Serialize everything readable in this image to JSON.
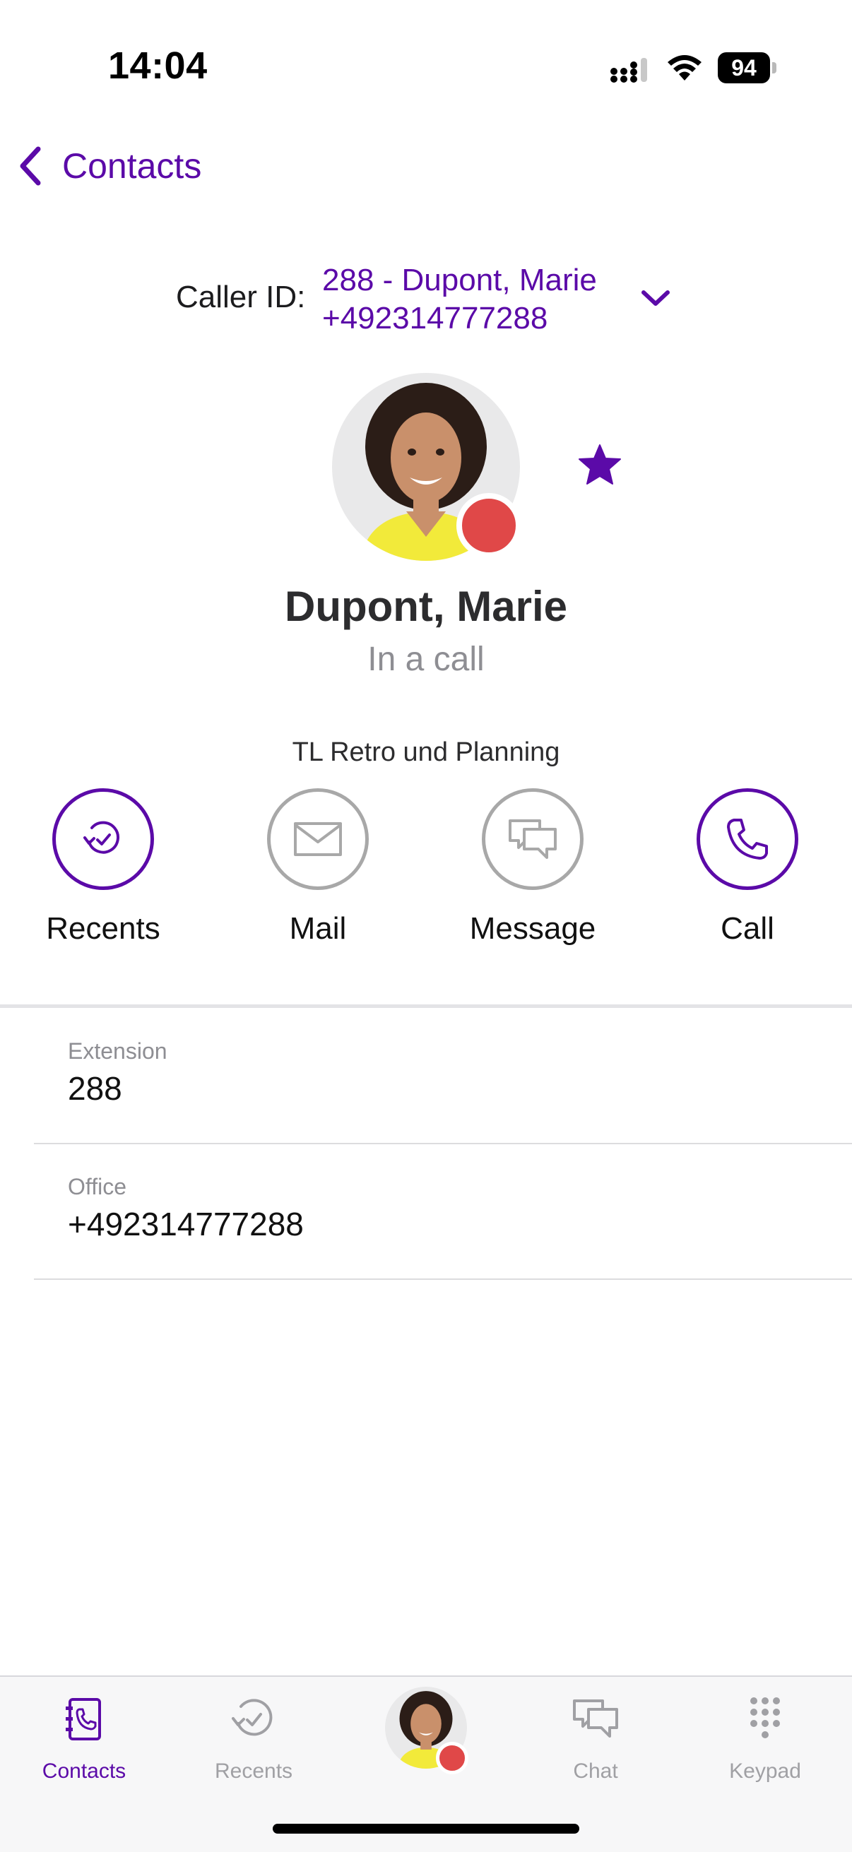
{
  "status_bar": {
    "time": "14:04",
    "battery": "94"
  },
  "nav": {
    "back_label": "Contacts"
  },
  "caller_id": {
    "label": "Caller ID:",
    "line1": "288 - Dupont, Marie",
    "line2": "+492314777288"
  },
  "contact": {
    "name": "Dupont, Marie",
    "status": "In a call",
    "note": "TL Retro und Planning",
    "favorite": true
  },
  "colors": {
    "accent": "#5b0aa8",
    "presence_busy": "#e04848",
    "inactive": "#a8a8a8"
  },
  "actions": [
    {
      "label": "Recents",
      "icon": "recents-icon",
      "enabled": true
    },
    {
      "label": "Mail",
      "icon": "mail-icon",
      "enabled": false
    },
    {
      "label": "Message",
      "icon": "message-icon",
      "enabled": false
    },
    {
      "label": "Call",
      "icon": "phone-icon",
      "enabled": true
    }
  ],
  "fields": [
    {
      "label": "Extension",
      "value": "288"
    },
    {
      "label": "Office",
      "value": "+492314777288"
    }
  ],
  "tab_bar": {
    "tabs": [
      {
        "label": "Contacts",
        "icon": "contacts-icon",
        "active": true
      },
      {
        "label": "Recents",
        "icon": "recents-icon",
        "active": false
      },
      {
        "label": "Chat",
        "icon": "chat-icon",
        "active": false
      },
      {
        "label": "Keypad",
        "icon": "keypad-icon",
        "active": false
      }
    ]
  }
}
